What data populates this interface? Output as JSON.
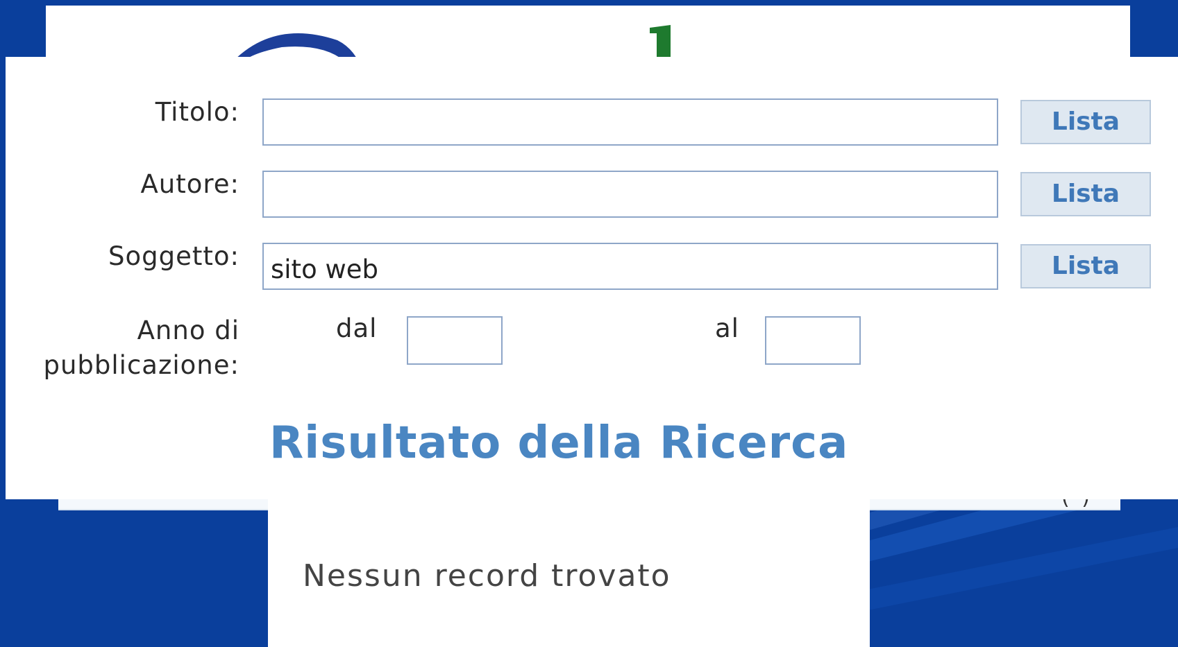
{
  "form": {
    "titolo_label": "Titolo:",
    "titolo_value": "",
    "autore_label": "Autore:",
    "autore_value": "",
    "soggetto_label": "Soggetto:",
    "soggetto_value": "sito web",
    "lista_label": "Lista",
    "anno_label_line1": "Anno di",
    "anno_label_line2": "pubblicazione:",
    "dal_label": "dal",
    "dal_value": "",
    "al_label": "al",
    "al_value": ""
  },
  "results": {
    "heading": "Risultato della Ricerca",
    "message": "Nessun record trovato"
  },
  "colors": {
    "background": "#0a3f9c",
    "heading": "#4a86c2",
    "button_text": "#3f78b8",
    "button_bg": "#dfe8f1"
  }
}
